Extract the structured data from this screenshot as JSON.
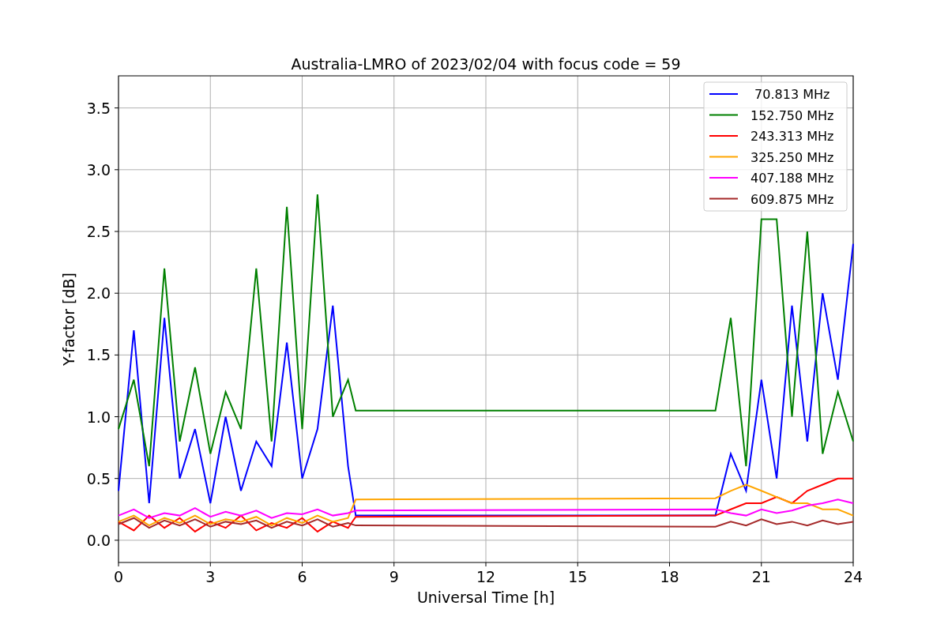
{
  "chart_data": {
    "type": "line",
    "title": "Australia-LMRO of 2023/02/04 with focus code = 59",
    "xlabel": "Universal Time [h]",
    "ylabel": "Y-factor [dB]",
    "x": [
      0,
      0.5,
      1,
      1.5,
      2,
      2.5,
      3,
      3.5,
      4,
      4.5,
      5,
      5.5,
      6,
      6.5,
      7,
      7.5,
      7.75,
      19.5,
      20,
      20.5,
      21,
      21.5,
      22,
      22.5,
      23,
      23.5,
      24
    ],
    "series": [
      {
        "name": " 70.813 MHz",
        "color": "#0000ff",
        "values": [
          0.4,
          1.7,
          0.3,
          1.8,
          0.5,
          0.9,
          0.3,
          1.0,
          0.4,
          0.8,
          0.6,
          1.6,
          0.5,
          0.9,
          1.9,
          0.6,
          0.2,
          0.2,
          0.7,
          0.4,
          1.3,
          0.5,
          1.9,
          0.8,
          2.0,
          1.3,
          2.4
        ]
      },
      {
        "name": "152.750 MHz",
        "color": "#008000",
        "values": [
          0.9,
          1.3,
          0.6,
          2.2,
          0.8,
          1.4,
          0.7,
          1.2,
          0.9,
          2.2,
          0.8,
          2.7,
          0.9,
          2.8,
          1.0,
          1.3,
          1.05,
          1.05,
          1.8,
          0.6,
          2.6,
          2.6,
          1.0,
          2.5,
          0.7,
          1.2,
          0.8
        ]
      },
      {
        "name": "243.313 MHz",
        "color": "#ff0000",
        "values": [
          0.15,
          0.08,
          0.2,
          0.1,
          0.18,
          0.07,
          0.15,
          0.1,
          0.2,
          0.08,
          0.14,
          0.1,
          0.18,
          0.07,
          0.15,
          0.1,
          0.19,
          0.2,
          0.25,
          0.3,
          0.3,
          0.35,
          0.3,
          0.4,
          0.45,
          0.5,
          0.5
        ]
      },
      {
        "name": "325.250 MHz",
        "color": "#ffa500",
        "values": [
          0.15,
          0.2,
          0.12,
          0.18,
          0.14,
          0.2,
          0.13,
          0.17,
          0.15,
          0.19,
          0.12,
          0.18,
          0.14,
          0.2,
          0.15,
          0.18,
          0.33,
          0.34,
          0.4,
          0.45,
          0.4,
          0.35,
          0.3,
          0.3,
          0.25,
          0.25,
          0.2
        ]
      },
      {
        "name": "407.188 MHz",
        "color": "#ff00ff",
        "values": [
          0.2,
          0.25,
          0.18,
          0.22,
          0.2,
          0.26,
          0.19,
          0.23,
          0.2,
          0.24,
          0.18,
          0.22,
          0.21,
          0.25,
          0.2,
          0.22,
          0.24,
          0.25,
          0.22,
          0.2,
          0.25,
          0.22,
          0.24,
          0.28,
          0.3,
          0.33,
          0.3
        ]
      },
      {
        "name": "609.875 MHz",
        "color": "#a52a2a",
        "values": [
          0.13,
          0.18,
          0.1,
          0.16,
          0.12,
          0.17,
          0.11,
          0.15,
          0.13,
          0.16,
          0.1,
          0.15,
          0.12,
          0.17,
          0.11,
          0.14,
          0.12,
          0.11,
          0.15,
          0.12,
          0.17,
          0.13,
          0.15,
          0.12,
          0.16,
          0.13,
          0.15
        ]
      }
    ],
    "grid": true,
    "legend": true,
    "xlim": [
      0,
      24
    ],
    "ylim": [
      -0.18,
      3.76
    ],
    "xticks": [
      0,
      3,
      6,
      9,
      12,
      15,
      18,
      21,
      24
    ],
    "yticks": [
      {
        "value": 0,
        "label": "0.0"
      },
      {
        "value": 0.5,
        "label": "0.5"
      },
      {
        "value": 1,
        "label": "1.0"
      },
      {
        "value": 1.5,
        "label": "1.5"
      },
      {
        "value": 2,
        "label": "2.0"
      },
      {
        "value": 2.5,
        "label": "2.5"
      },
      {
        "value": 3,
        "label": "3.0"
      },
      {
        "value": 3.5,
        "label": "3.5"
      }
    ]
  }
}
